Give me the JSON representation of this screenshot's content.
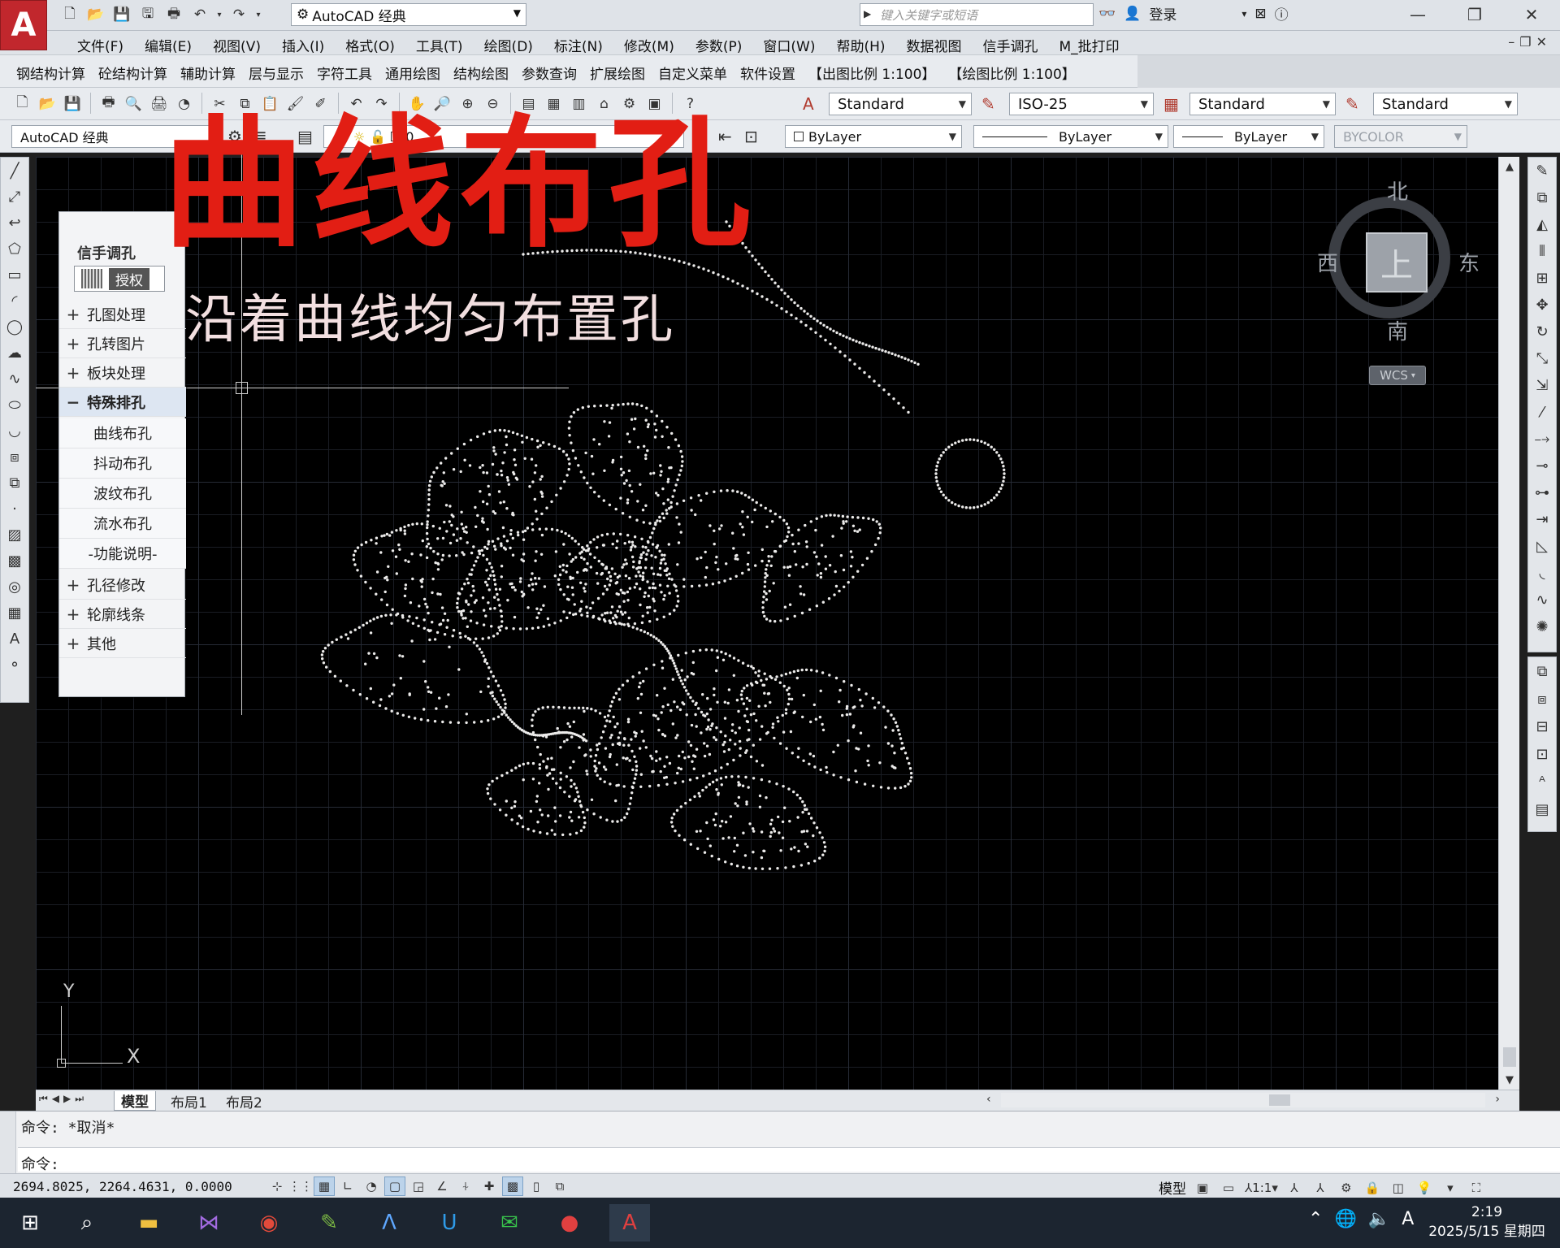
{
  "titlebar": {
    "workspace": "AutoCAD 经典",
    "search_placeholder": "键入关键字或短语",
    "login": "登录"
  },
  "menubar": {
    "items": [
      "文件(F)",
      "编辑(E)",
      "视图(V)",
      "插入(I)",
      "格式(O)",
      "工具(T)",
      "绘图(D)",
      "标注(N)",
      "修改(M)",
      "参数(P)",
      "窗口(W)",
      "帮助(H)",
      "数据视图",
      "信手调孔",
      "M_批打印"
    ]
  },
  "custombar": {
    "items": [
      "钢结构计算",
      "砼结构计算",
      "辅助计算",
      "层与显示",
      "字符工具",
      "通用绘图",
      "结构绘图",
      "参数查询",
      "扩展绘图",
      "自定义菜单",
      "软件设置",
      "【出图比例 1:100】",
      "【绘图比例 1:100】"
    ]
  },
  "styles": {
    "text_style": "Standard",
    "dim_style": "ISO-25",
    "table_style": "Standard",
    "mleader_style": "Standard"
  },
  "layerbar": {
    "workspace": "AutoCAD 经典",
    "layer": "0",
    "color": "ByLayer",
    "linetype": "ByLayer",
    "lineweight": "ByLayer",
    "plotstyle": "BYCOLOR"
  },
  "overlay": {
    "title": "曲线布孔",
    "subtitle": "沿着曲线均匀布置孔"
  },
  "panel": {
    "title": "信手调孔",
    "auth_label": "授权",
    "items": [
      {
        "mark": "+",
        "label": "孔图处理"
      },
      {
        "mark": "+",
        "label": "孔转图片"
      },
      {
        "mark": "+",
        "label": "板块处理"
      },
      {
        "mark": "−",
        "label": "特殊排孔"
      }
    ],
    "subitems": [
      "曲线布孔",
      "抖动布孔",
      "波纹布孔",
      "流水布孔",
      "-功能说明-"
    ],
    "items2": [
      {
        "mark": "+",
        "label": "孔径修改"
      },
      {
        "mark": "+",
        "label": "轮廓线条"
      },
      {
        "mark": "+",
        "label": "其他"
      }
    ]
  },
  "viewcube": {
    "north": "北",
    "south": "南",
    "east": "东",
    "west": "西",
    "top": "上",
    "wcs": "WCS"
  },
  "ucs": {
    "x": "X",
    "y": "Y"
  },
  "tabs": [
    "模型",
    "布局1",
    "布局2"
  ],
  "command": {
    "history": "命令: *取消*",
    "prompt": "命令:"
  },
  "status": {
    "coords": "2694.8025, 2264.4631, 0.0000",
    "model": "模型",
    "scale": "1:1"
  },
  "taskbar": {
    "time": "2:19",
    "date": "2025/5/15 星期四",
    "ime": "A"
  }
}
